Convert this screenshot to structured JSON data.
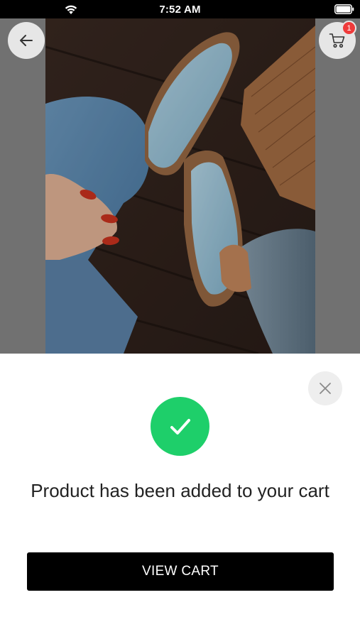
{
  "status_bar": {
    "time": "7:52 AM",
    "wifi_icon": "wifi-icon",
    "battery_icon": "battery-icon"
  },
  "header": {
    "back_icon": "arrow-left-icon",
    "cart_icon": "cart-icon",
    "cart_badge_count": "1",
    "badge_color": "#ef3b3b"
  },
  "product_image": {
    "subject": "sneakers photo"
  },
  "sheet": {
    "close_icon": "close-icon",
    "success_icon": "checkmark-icon",
    "success_color": "#1ecf6a",
    "message": "Product has been added to your cart",
    "view_cart_label": "VIEW CART"
  }
}
